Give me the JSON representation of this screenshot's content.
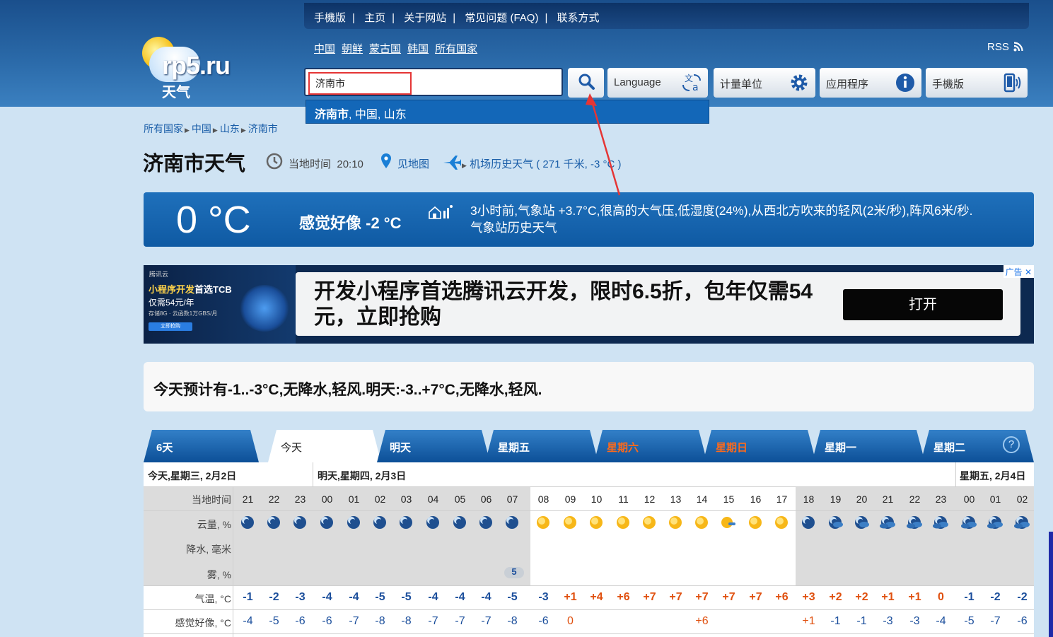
{
  "topnav": [
    "手機版",
    "主页",
    "关于网站",
    "常见问题 (FAQ)",
    "联系方式"
  ],
  "logo": {
    "text": "rp5.ru",
    "sub": "天气"
  },
  "countries": [
    "中国",
    "朝鲜",
    "蒙古国",
    "韩国",
    "所有国家"
  ],
  "rss": "RSS",
  "search": {
    "value": "济南市"
  },
  "toolbar": {
    "language": "Language",
    "units": "计量单位",
    "apps": "应用程序",
    "mobile": "手機版"
  },
  "suggestion": {
    "bold": "济南市",
    "rest": ", 中国, 山东"
  },
  "breadcrumb": [
    "所有国家",
    "中国",
    "山东",
    "济南市"
  ],
  "title": "济南市天气",
  "meta": {
    "local_time_label": "当地时间",
    "local_time": "20:10",
    "map": "见地图",
    "airport": "机场历史天气 ( 271 千米, -3 °C )"
  },
  "current": {
    "temp": "0 °C",
    "feels": "感觉好像 -2 °C",
    "line1": "3小时前,气象站 +3.7°C,很高的大气压,低湿度(24%),从西北方吹来的轻风(2米/秒),阵风6米/秒.",
    "line2": "气象站历史天气"
  },
  "ad": {
    "brand": "腾讯云",
    "l1a": "小程序开发",
    "l1b": "首选TCB",
    "l2": "仅需54元/年",
    "l3": "存储8G · 云函数1万GBS/月",
    "small_btn": "立即抢购",
    "main": "开发小程序首选腾讯云开发，限时6.5折，包年仅需54元，立即抢购",
    "open": "打开",
    "label": "广告"
  },
  "summary": "今天预计有-1..-3°C,无降水,轻风.明天:-3..+7°C,无降水,轻风.",
  "tabs": [
    "6天",
    "今天",
    "明天",
    "星期五",
    "星期六",
    "星期日",
    "星期一",
    "星期二"
  ],
  "help": "?",
  "days": [
    "今天,星期三, 2月2日",
    "明天,星期四, 2月3日",
    "星期五, 2月4日"
  ],
  "row_labels": {
    "time": "当地时间",
    "cloud": "云量, %",
    "precip": "降水, 毫米",
    "fog": "雾, %",
    "temp": "气温, °C",
    "feel": "感觉好像, °C"
  },
  "hours": [
    "21",
    "22",
    "23",
    "00",
    "01",
    "02",
    "03",
    "04",
    "05",
    "06",
    "07",
    "08",
    "09",
    "10",
    "11",
    "12",
    "13",
    "14",
    "15",
    "16",
    "17",
    "18",
    "19",
    "20",
    "21",
    "22",
    "23",
    "00",
    "01",
    "02"
  ],
  "fog_value": "5",
  "temps": [
    "-1",
    "-2",
    "-3",
    "-4",
    "-4",
    "-5",
    "-5",
    "-4",
    "-4",
    "-4",
    "-5",
    "-3",
    "+1",
    "+4",
    "+6",
    "+7",
    "+7",
    "+7",
    "+7",
    "+7",
    "+6",
    "+3",
    "+2",
    "+2",
    "+1",
    "+1",
    "0",
    "-1",
    "-2",
    "-2"
  ],
  "feels": [
    "-4",
    "-5",
    "-6",
    "-6",
    "-7",
    "-8",
    "-8",
    "-7",
    "-7",
    "-7",
    "-8",
    "-6",
    "0",
    "",
    "",
    "",
    "",
    "+6",
    "",
    "",
    "",
    "+1",
    "-1",
    "-1",
    "-3",
    "-3",
    "-4",
    "-5",
    "-7",
    "-6"
  ],
  "cloud_icons": [
    "moon",
    "moon",
    "moon",
    "moon",
    "moon",
    "moon",
    "moon",
    "moon",
    "moon",
    "moon",
    "moon",
    "sun",
    "sun",
    "sun",
    "sun",
    "sun",
    "sun",
    "sun",
    "sun-cloud",
    "sun",
    "sun",
    "moon",
    "moon-cloud",
    "moon-cloud",
    "moon-clouds",
    "moon-clouds",
    "moon-clouds",
    "moon-clouds",
    "moon-clouds",
    "moon-clouds"
  ],
  "colors": {
    "accent": "#1367b8",
    "header": "#1a4f8c",
    "weekend": "#ff6a1a",
    "cold": "#1c4f9c",
    "warm": "#e0500f"
  }
}
